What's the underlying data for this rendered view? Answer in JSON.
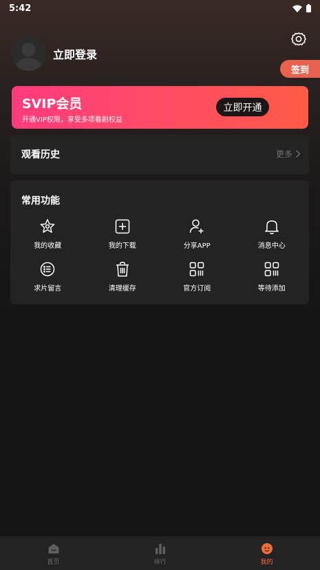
{
  "status": {
    "time": "5:42"
  },
  "profile": {
    "login_label": "立即登录"
  },
  "checkin": {
    "label": "签到"
  },
  "svip": {
    "title": "SVIP会员",
    "subtitle": "开通VIP权限，享受多项看剧权益",
    "button_label": "立即开通"
  },
  "history": {
    "title": "观看历史",
    "more_label": "更多"
  },
  "functions": {
    "title": "常用功能",
    "items": [
      {
        "label": "我的收藏",
        "icon": "star-icon"
      },
      {
        "label": "我的下载",
        "icon": "download-box-icon"
      },
      {
        "label": "分享APP",
        "icon": "user-add-icon"
      },
      {
        "label": "消息中心",
        "icon": "bell-icon"
      },
      {
        "label": "求片留言",
        "icon": "list-circle-icon"
      },
      {
        "label": "清理缓存",
        "icon": "trash-icon"
      },
      {
        "label": "官方订阅",
        "icon": "grid-icon"
      },
      {
        "label": "等待添加",
        "icon": "grid-icon"
      }
    ]
  },
  "nav": {
    "items": [
      {
        "label": "首页",
        "icon": "home-icon"
      },
      {
        "label": "排行",
        "icon": "chart-icon"
      },
      {
        "label": "我的",
        "icon": "profile-face-icon",
        "active": true
      }
    ]
  },
  "colors": {
    "accent": "#f26b3a",
    "checkin": "#e7624f",
    "card": "#232323"
  }
}
